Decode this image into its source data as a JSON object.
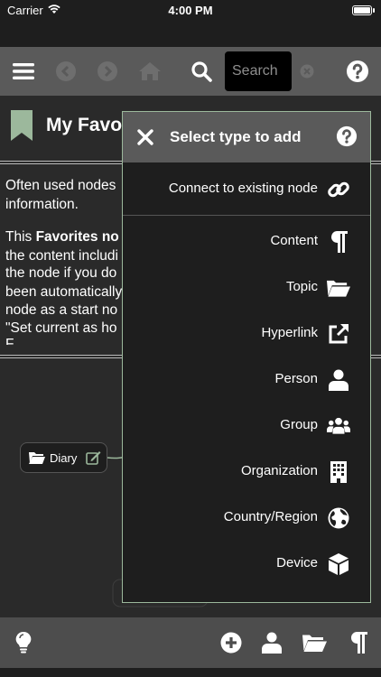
{
  "status_bar": {
    "carrier": "Carrier",
    "time": "4:00 PM"
  },
  "toolbar": {
    "search_placeholder": "Search"
  },
  "favorites": {
    "title": "My Favor",
    "desc_lines": [
      "Often used nodes",
      "information.",
      "",
      "This Favorites no",
      "the content includi",
      "the node if you do",
      "been automatically",
      "node as a start no",
      "\"Set current as ho",
      "F"
    ]
  },
  "graph": {
    "diary_label": "Diary"
  },
  "dialog": {
    "title": "Select type to add",
    "connect_label": "Connect to existing node",
    "items": [
      {
        "label": "Content",
        "icon": "paragraph-icon"
      },
      {
        "label": "Topic",
        "icon": "folder-icon"
      },
      {
        "label": "Hyperlink",
        "icon": "external-link-icon"
      },
      {
        "label": "Person",
        "icon": "person-icon"
      },
      {
        "label": "Group",
        "icon": "group-icon"
      },
      {
        "label": "Organization",
        "icon": "building-icon"
      },
      {
        "label": "Country/Region",
        "icon": "globe-icon"
      },
      {
        "label": "Device",
        "icon": "cube-icon"
      }
    ]
  },
  "colors": {
    "accent_green": "#9cb89c",
    "toolbar": "#5a5a5a",
    "background": "#2a2a2a"
  }
}
